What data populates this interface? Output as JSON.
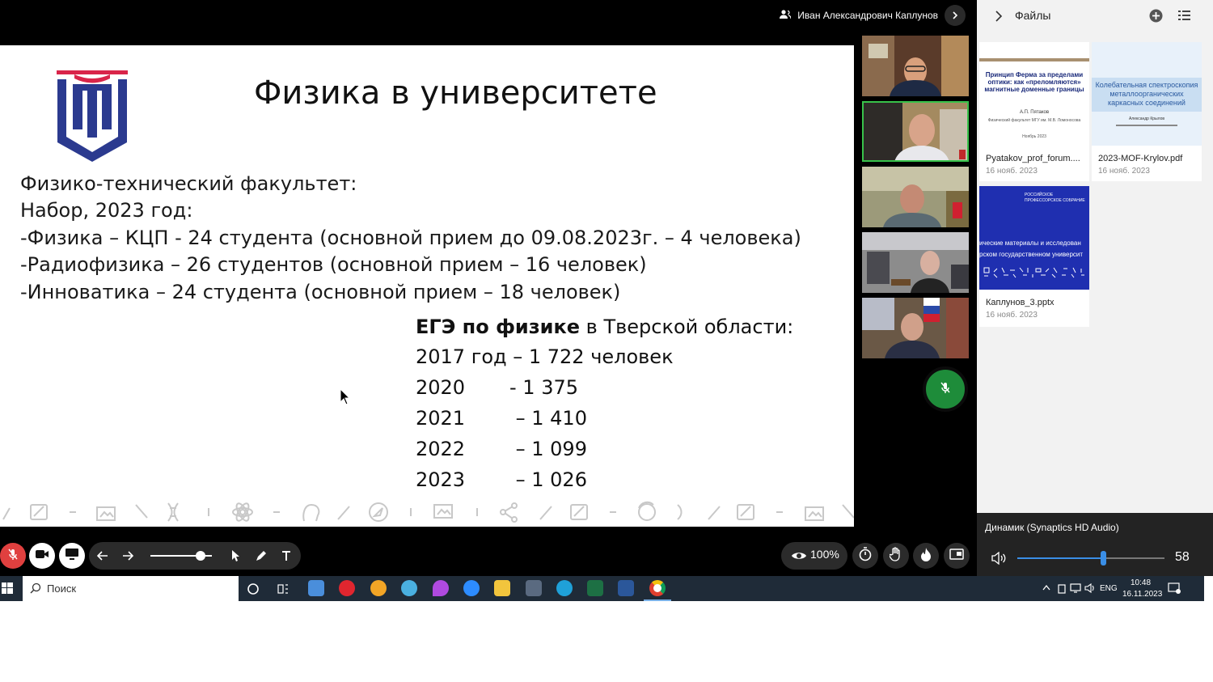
{
  "conference": {
    "presenter_name": "Иван Александрович Каплунов"
  },
  "slide": {
    "title": "Физика в университете",
    "lines": [
      "Физико-технический факультет:",
      "Набор, 2023 год:",
      "-Физика – КЦП - 24 студента  (основной прием до 09.08.2023г. – 4 человека)",
      "-Радиофизика – 26 студентов (основной прием – 16 человек)",
      "-Инноватика – 24 студента (основной прием – 18 человек)"
    ],
    "ege_heading_bold": "ЕГЭ по физике",
    "ege_heading_rest": " в Тверской области:",
    "ege_first": "2017 год – 1 722 человек",
    "ege_rows": [
      {
        "year": "2020",
        "value": "-  1 375"
      },
      {
        "year": "2021",
        "value": " – 1 410"
      },
      {
        "year": "2022",
        "value": " – 1 099"
      },
      {
        "year": "2023",
        "value": " – 1 026"
      }
    ]
  },
  "controls": {
    "zoom": "100%",
    "slider_level": 0.82
  },
  "files_panel": {
    "title": "Файлы",
    "files": [
      {
        "name": "Pyatakov_prof_forum....",
        "date": "16 нояб. 2023",
        "thumb_title": "Принцип Ферма за пределами оптики: как «преломляются» магнитные доменные границы",
        "thumb_author": "А.П. Пятаков",
        "thumb_org": "Физический факультет МГУ им. М.В. Ломоносова",
        "thumb_date": "Ноябрь 2023"
      },
      {
        "name": "2023-MOF-Krylov.pdf",
        "date": "16 нояб. 2023",
        "thumb_title": "Колебательная спектроскопия металлоорганических каркасных соединений",
        "thumb_author": "Александр Крылов"
      },
      {
        "name": "Каплунов_3.pptx",
        "date": "16 нояб. 2023",
        "thumb_header": "РОССИЙСКОЕ ПРОФЕССОРСКОЕ СОБРАНИЕ",
        "thumb_title": "ические материалы и исследован рском государственном университ"
      }
    ]
  },
  "audio": {
    "device": "Динамик (Synaptics HD Audio)",
    "volume": "58",
    "volume_level": 0.58
  },
  "taskbar": {
    "search_placeholder": "Поиск",
    "lang": "ENG",
    "time": "10:48",
    "date": "16.11.2023"
  },
  "colors": {
    "accent_green": "#38c24a",
    "mic_red": "#e0403f",
    "slide_logo_blue": "#2b3a8f",
    "slide_logo_red": "#d9254a",
    "taskbar": "#1f2b38"
  }
}
